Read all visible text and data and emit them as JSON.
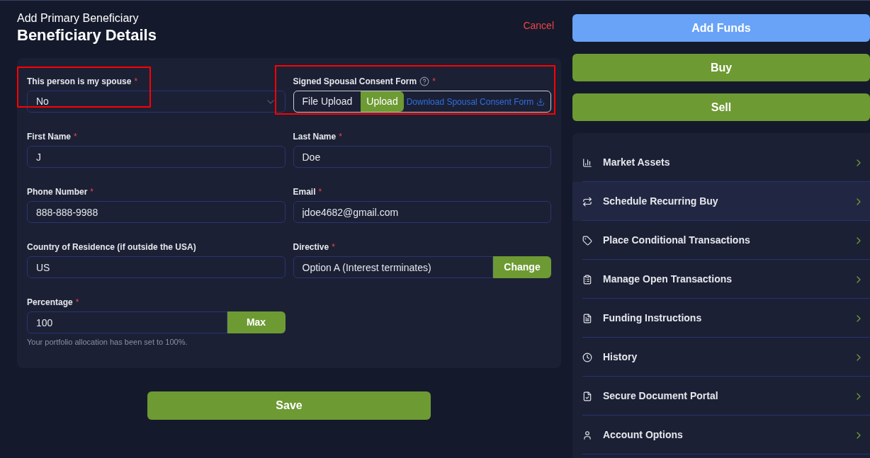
{
  "header": {
    "subtitle": "Add Primary Beneficiary",
    "title": "Beneficiary Details",
    "cancel": "Cancel"
  },
  "fields": [
    {
      "kind": "select",
      "label": "This person is my spouse",
      "required": "*",
      "value": "No",
      "annotated": true
    },
    {
      "kind": "upload",
      "label": "Signed Spousal Consent Form",
      "required": "*",
      "help": true,
      "file_label": "File Upload",
      "button": "Upload",
      "link": "Download Spousal Consent Form",
      "annotated": true
    },
    {
      "kind": "text",
      "label": "First Name",
      "required": "*",
      "value": "J"
    },
    {
      "kind": "text",
      "label": "Last Name",
      "required": "*",
      "value": "Doe"
    },
    {
      "kind": "text",
      "label": "Phone Number",
      "required": "*",
      "value": "888-888-9988"
    },
    {
      "kind": "text",
      "label": "Email",
      "required": "*",
      "value": "jdoe4682@gmail.com"
    },
    {
      "kind": "text",
      "label": "Country of Residence (if outside the USA)",
      "value": "US"
    },
    {
      "kind": "action",
      "label": "Directive",
      "required": "*",
      "value": "Option A (Interest terminates)",
      "button": "Change"
    },
    {
      "kind": "action",
      "label": "Percentage",
      "required": "*",
      "value": "100",
      "button": "Max",
      "hint": "Your portfolio allocation has been set to 100%."
    }
  ],
  "save": "Save",
  "actions": [
    {
      "label": "Add Funds",
      "kind": "primary"
    },
    {
      "label": "Buy",
      "kind": "success"
    },
    {
      "label": "Sell",
      "kind": "success"
    }
  ],
  "menu": [
    {
      "label": "Market Assets",
      "selected": false
    },
    {
      "label": "Schedule Recurring Buy",
      "selected": true
    },
    {
      "label": "Place Conditional Transactions",
      "selected": false
    },
    {
      "label": "Manage Open Transactions",
      "selected": false
    },
    {
      "label": "Funding Instructions",
      "selected": false
    },
    {
      "label": "History",
      "selected": false
    },
    {
      "label": "Secure Document Portal",
      "selected": false
    },
    {
      "label": "Account Options",
      "selected": false
    }
  ]
}
